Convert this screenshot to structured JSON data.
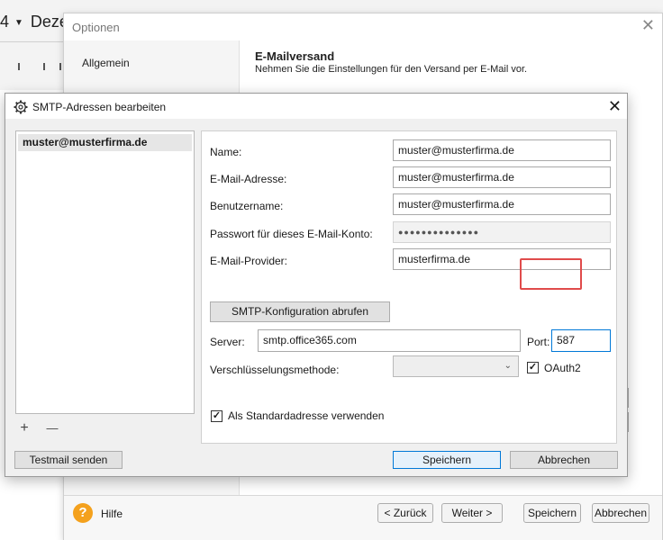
{
  "background": {
    "title_number": "4",
    "title_month": "Deze"
  },
  "options_dialog": {
    "title": "Optionen",
    "nav_item": "Allgemein",
    "heading": "E-Mailversand",
    "subheading": "Nehmen Sie die Einstellungen für den Versand per E-Mail vor.",
    "help_label": "Hilfe",
    "help_icon_glyph": "?",
    "buttons": {
      "back": "< Zurück",
      "next": "Weiter >",
      "save": "Speichern",
      "cancel": "Abbrechen"
    }
  },
  "smtp_dialog": {
    "title": "SMTP-Adressen bearbeiten",
    "accounts": [
      "muster@musterfirma.de"
    ],
    "form": {
      "name_label": "Name:",
      "name_value": "muster@musterfirma.de",
      "email_label": "E-Mail-Adresse:",
      "email_value": "muster@musterfirma.de",
      "user_label": "Benutzername:",
      "user_value": "muster@musterfirma.de",
      "password_label": "Passwort für dieses E-Mail-Konto:",
      "password_value": "●●●●●●●●●●●●●●",
      "provider_label": "E-Mail-Provider:",
      "provider_value": "musterfirma.de",
      "fetch_button": "SMTP-Konfiguration abrufen",
      "server_label": "Server:",
      "server_value": "smtp.office365.com",
      "port_label": "Port:",
      "port_value": "587",
      "encryption_label": "Verschlüsselungsmethode:",
      "encryption_value": "",
      "oauth_label": "OAuth2",
      "oauth_checked": true,
      "default_label": "Als Standardadresse verwenden",
      "default_checked": true
    },
    "buttons": {
      "add": "+",
      "remove": "—",
      "test": "Testmail senden",
      "save": "Speichern",
      "cancel": "Abbrechen"
    }
  },
  "colors": {
    "highlight": "#e04b4b",
    "primary_border": "#0078d7",
    "help_icon": "#f4a11d"
  }
}
